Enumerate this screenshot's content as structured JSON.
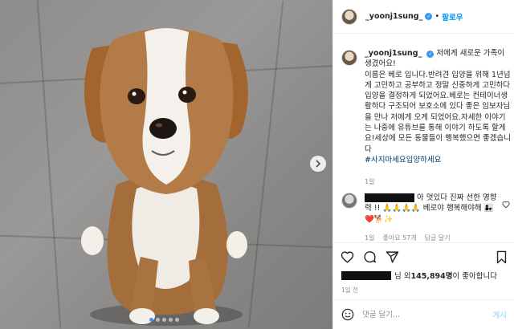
{
  "post": {
    "author": "_yoonj1sung_",
    "follow_label": "팔로우",
    "separator": "•",
    "caption": "저에게 새로운 가족이 생겼어요!\n이름은 베로 입니다.반려견 입양을 위해 1년넘게 고민하고 공부하고 정말 신중하게 고민하다 입양을 결정하게 되었어요.베로는 컨테이너생활하다 구조되어 보호소에 있다 좋은 임보자님을 만나 저에게 오게 되었어요.자세한 이야기는 나중에 유튜브를 통해 이야기 하도록 할게요!세상에 모든 동물들이 행복했으면 좋겠습니다",
    "hashtag": "#사지마세요입양하세요",
    "caption_time": "1일"
  },
  "comment": {
    "text": "아 멋있다 진짜 선한 영향력 !! 🙏🙏🙏🙏 베로야 행복해야해 👩‍👧❤️🐕✨",
    "time": "1일",
    "likes": "좋아요 57개",
    "reply": "답글 달기"
  },
  "likes": {
    "prefix": "님 외 ",
    "count": "145,894명",
    "suffix": "이 좋아합니다"
  },
  "date": "1일 전",
  "comment_input": {
    "placeholder": "댓글 달기...",
    "post_label": "게시"
  },
  "carousel": {
    "total": 5,
    "active": 0
  },
  "icons": [
    "heart-icon",
    "comment-icon",
    "share-icon",
    "bookmark-icon",
    "emoji-icon",
    "verified-icon",
    "next-arrow-icon"
  ],
  "colors": {
    "accent": "#0095f6",
    "hashtag": "#00376b",
    "muted": "#8e8e8e",
    "post_disabled": "#b2dffc"
  }
}
